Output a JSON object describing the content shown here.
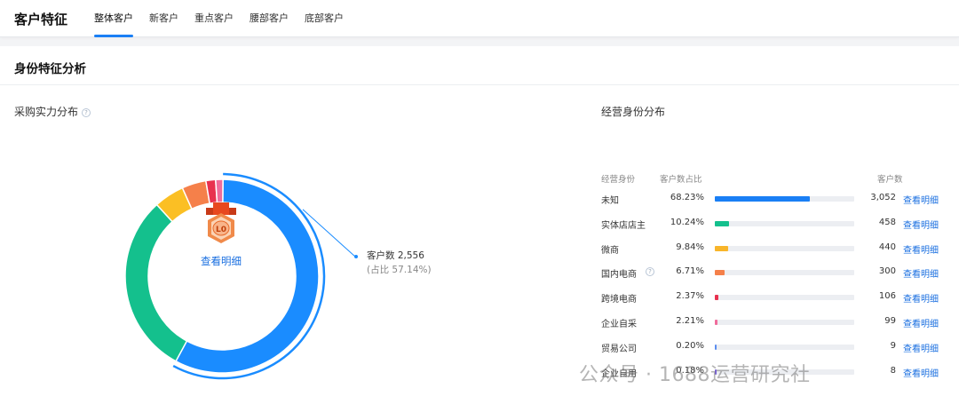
{
  "topbar": {
    "title": "客户特征",
    "tabs": [
      "整体客户",
      "新客户",
      "重点客户",
      "腰部客户",
      "底部客户"
    ],
    "active_tab": 0
  },
  "section": {
    "title": "身份特征分析"
  },
  "left_panel": {
    "title": "采购实力分布",
    "help_icon": "question-circle-icon",
    "badge_icon": "medal-l0-icon",
    "badge_text": "L0",
    "center_link": "查看明细",
    "tooltip": {
      "label": "客户数 2,556",
      "sub": "(占比 57.14%)"
    }
  },
  "right_panel": {
    "title": "经营身份分布",
    "headers": {
      "identity": "经营身份",
      "share": "客户数占比",
      "count": "客户数"
    },
    "rows": [
      {
        "name": "未知",
        "pct": "68.23%",
        "value": 68.23,
        "count": "3,052",
        "link": "查看明细",
        "color": "#1a7ff5"
      },
      {
        "name": "实体店店主",
        "pct": "10.24%",
        "value": 10.24,
        "count": "458",
        "link": "查看明细",
        "color": "#14c08d"
      },
      {
        "name": "微商",
        "pct": "9.84%",
        "value": 9.84,
        "count": "440",
        "link": "查看明细",
        "color": "#f8b52a"
      },
      {
        "name": "国内电商",
        "pct": "6.71%",
        "value": 6.71,
        "count": "300",
        "link": "查看明细",
        "color": "#f5804a",
        "help": true
      },
      {
        "name": "跨境电商",
        "pct": "2.37%",
        "value": 2.37,
        "count": "106",
        "link": "查看明细",
        "color": "#e8314f"
      },
      {
        "name": "企业自采",
        "pct": "2.21%",
        "value": 2.21,
        "count": "99",
        "link": "查看明细",
        "color": "#f06c9b"
      },
      {
        "name": "贸易公司",
        "pct": "0.20%",
        "value": 0.2,
        "count": "9",
        "link": "查看明细",
        "color": "#5b8def"
      },
      {
        "name": "企业自用",
        "pct": "0.18%",
        "value": 0.18,
        "count": "8",
        "link": "查看明细",
        "color": "#7a62d8"
      }
    ]
  },
  "chart_data": {
    "type": "pie",
    "title": "采购实力分布",
    "slices": [
      {
        "name": "L0",
        "value": 57.14,
        "color": "#1a8cff"
      },
      {
        "name": "",
        "value": 30.0,
        "color": "#14c08d"
      },
      {
        "name": "",
        "value": 5.0,
        "color": "#fbbf24"
      },
      {
        "name": "",
        "value": 4.0,
        "color": "#f5804a"
      },
      {
        "name": "",
        "value": 1.6,
        "color": "#e8314f"
      },
      {
        "name": "",
        "value": 1.2,
        "color": "#f06c9b"
      }
    ],
    "highlight": "L0"
  },
  "watermark": "公众号 · 1688运营研究社"
}
